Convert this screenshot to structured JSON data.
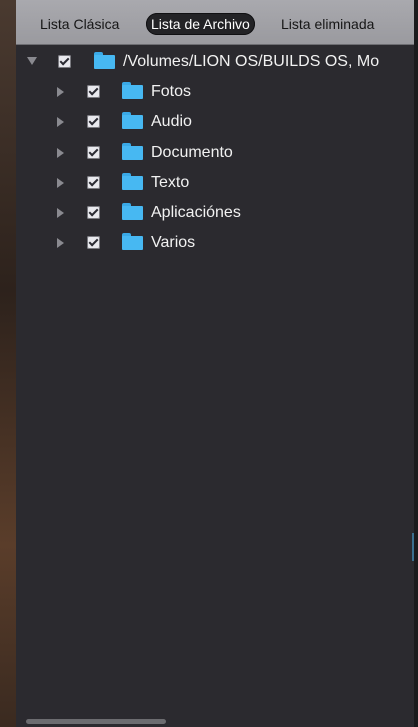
{
  "tabs": [
    {
      "label": "Lista Clásica",
      "selected": false
    },
    {
      "label": "Lista de Archivo",
      "selected": true
    },
    {
      "label": "Lista eliminada",
      "selected": false
    }
  ],
  "tree": {
    "root": {
      "label": "/Volumes/LION OS/BUILDS OS, Mo",
      "checked": true,
      "expanded": true
    },
    "children": [
      {
        "label": "Fotos",
        "checked": true,
        "expanded": false
      },
      {
        "label": "Audio",
        "checked": true,
        "expanded": false
      },
      {
        "label": "Documento",
        "checked": true,
        "expanded": false
      },
      {
        "label": "Texto",
        "checked": true,
        "expanded": false
      },
      {
        "label": "Aplicaciónes",
        "checked": true,
        "expanded": false
      },
      {
        "label": "Varios",
        "checked": true,
        "expanded": false
      }
    ]
  },
  "colors": {
    "panel_bg": "#2b2a2f",
    "tabbar_bg": "#a9a9ae",
    "selected_tab_bg": "#232326",
    "folder": "#47b8f2",
    "text": "#f2f2f2"
  },
  "icons": {
    "folder": "folder-icon",
    "disclosure_expanded": "triangle-down-icon",
    "disclosure_collapsed": "triangle-right-icon",
    "checkbox": "checkbox-checked-icon"
  }
}
